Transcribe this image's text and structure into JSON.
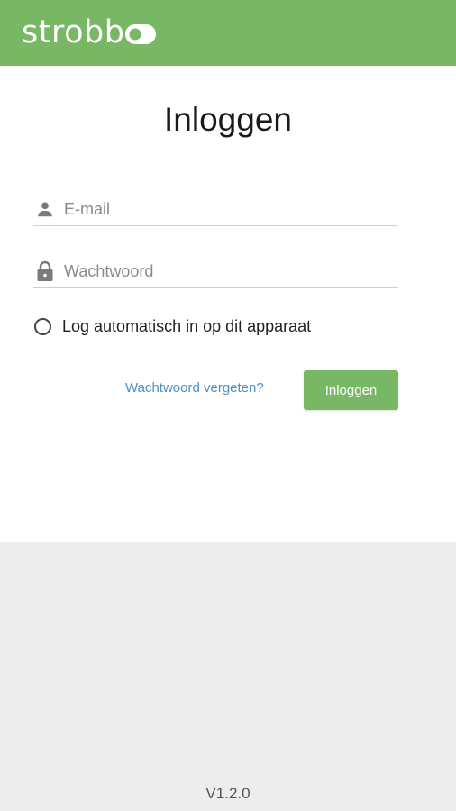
{
  "header": {
    "logo_text": "strobb",
    "brand_color": "#78b865"
  },
  "login": {
    "title": "Inloggen",
    "email_placeholder": "E-mail",
    "email_value": "",
    "email_icon": "person-icon",
    "password_placeholder": "Wachtwoord",
    "password_value": "",
    "password_icon": "lock-icon",
    "remember_label": "Log automatisch in op dit apparaat",
    "remember_checked": false,
    "forgot_label": "Wachtwoord vergeten?",
    "submit_label": "Inloggen",
    "link_color": "#4a90c8"
  },
  "footer": {
    "version": "V1.2.0"
  }
}
